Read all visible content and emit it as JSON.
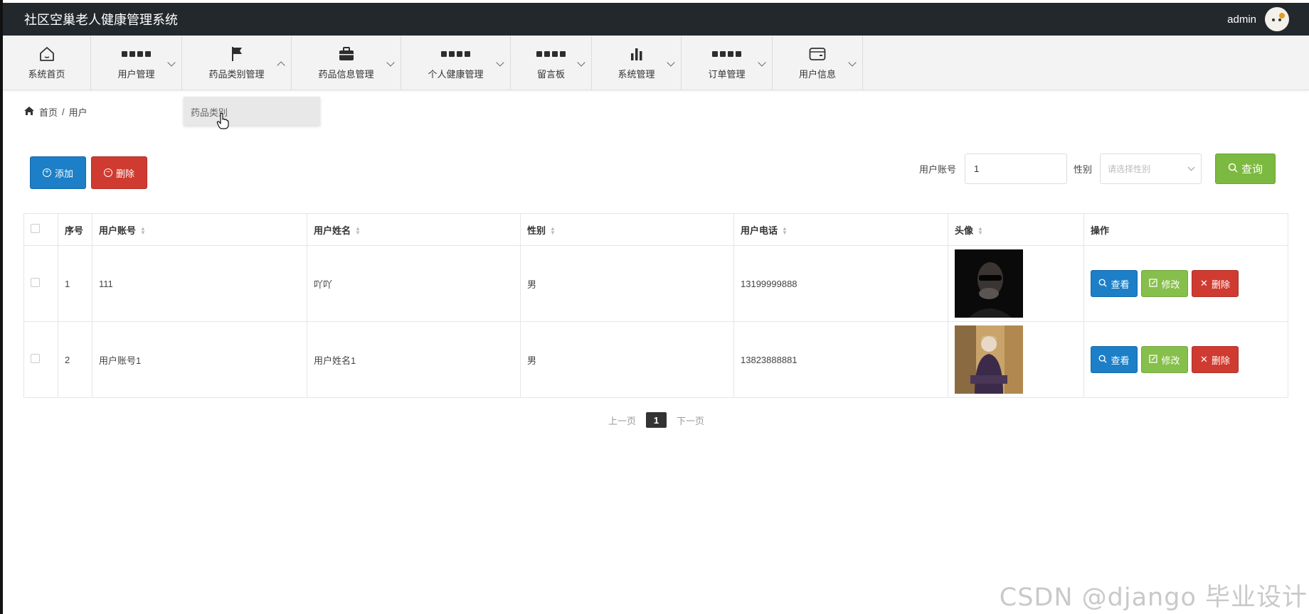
{
  "app": {
    "title": "社区空巢老人健康管理系统",
    "user": "admin"
  },
  "nav": [
    {
      "label": "系统首页",
      "icon": "home-icon"
    },
    {
      "label": "用户管理",
      "icon": "grid-icon"
    },
    {
      "label": "药品类别管理",
      "icon": "flag-icon"
    },
    {
      "label": "药品信息管理",
      "icon": "briefcase-icon"
    },
    {
      "label": "个人健康管理",
      "icon": "grid-icon"
    },
    {
      "label": "留言板",
      "icon": "grid-icon"
    },
    {
      "label": "系统管理",
      "icon": "bar-chart-icon"
    },
    {
      "label": "订单管理",
      "icon": "grid-icon"
    },
    {
      "label": "用户信息",
      "icon": "card-icon"
    }
  ],
  "dropdown": {
    "item": "药品类别"
  },
  "breadcrumb": {
    "home": "首页",
    "sep": "/",
    "current": "用户"
  },
  "toolbar": {
    "add_label": "添加",
    "delete_label": "删除"
  },
  "search": {
    "account_label": "用户账号",
    "account_value": "1",
    "gender_label": "性别",
    "gender_placeholder": "请选择性别",
    "query_label": "查询"
  },
  "table": {
    "headers": [
      "序号",
      "用户账号",
      "用户姓名",
      "性别",
      "用户电话",
      "头像",
      "操作"
    ],
    "rows": [
      {
        "index": "1",
        "account": "111",
        "name": "吖吖",
        "gender": "男",
        "phone": "13199999888"
      },
      {
        "index": "2",
        "account": "用户账号1",
        "name": "用户姓名1",
        "gender": "男",
        "phone": "13823888881"
      }
    ],
    "actions": {
      "view": "查看",
      "edit": "修改",
      "delete": "删除"
    }
  },
  "pagination": {
    "prev": "上一页",
    "current": "1",
    "next": "下一页"
  },
  "watermark": "CSDN @django 毕业设计",
  "colors": {
    "topbar": "#23282d",
    "primary": "#1c7fc7",
    "danger": "#cf3b30",
    "success": "#7cb940"
  }
}
